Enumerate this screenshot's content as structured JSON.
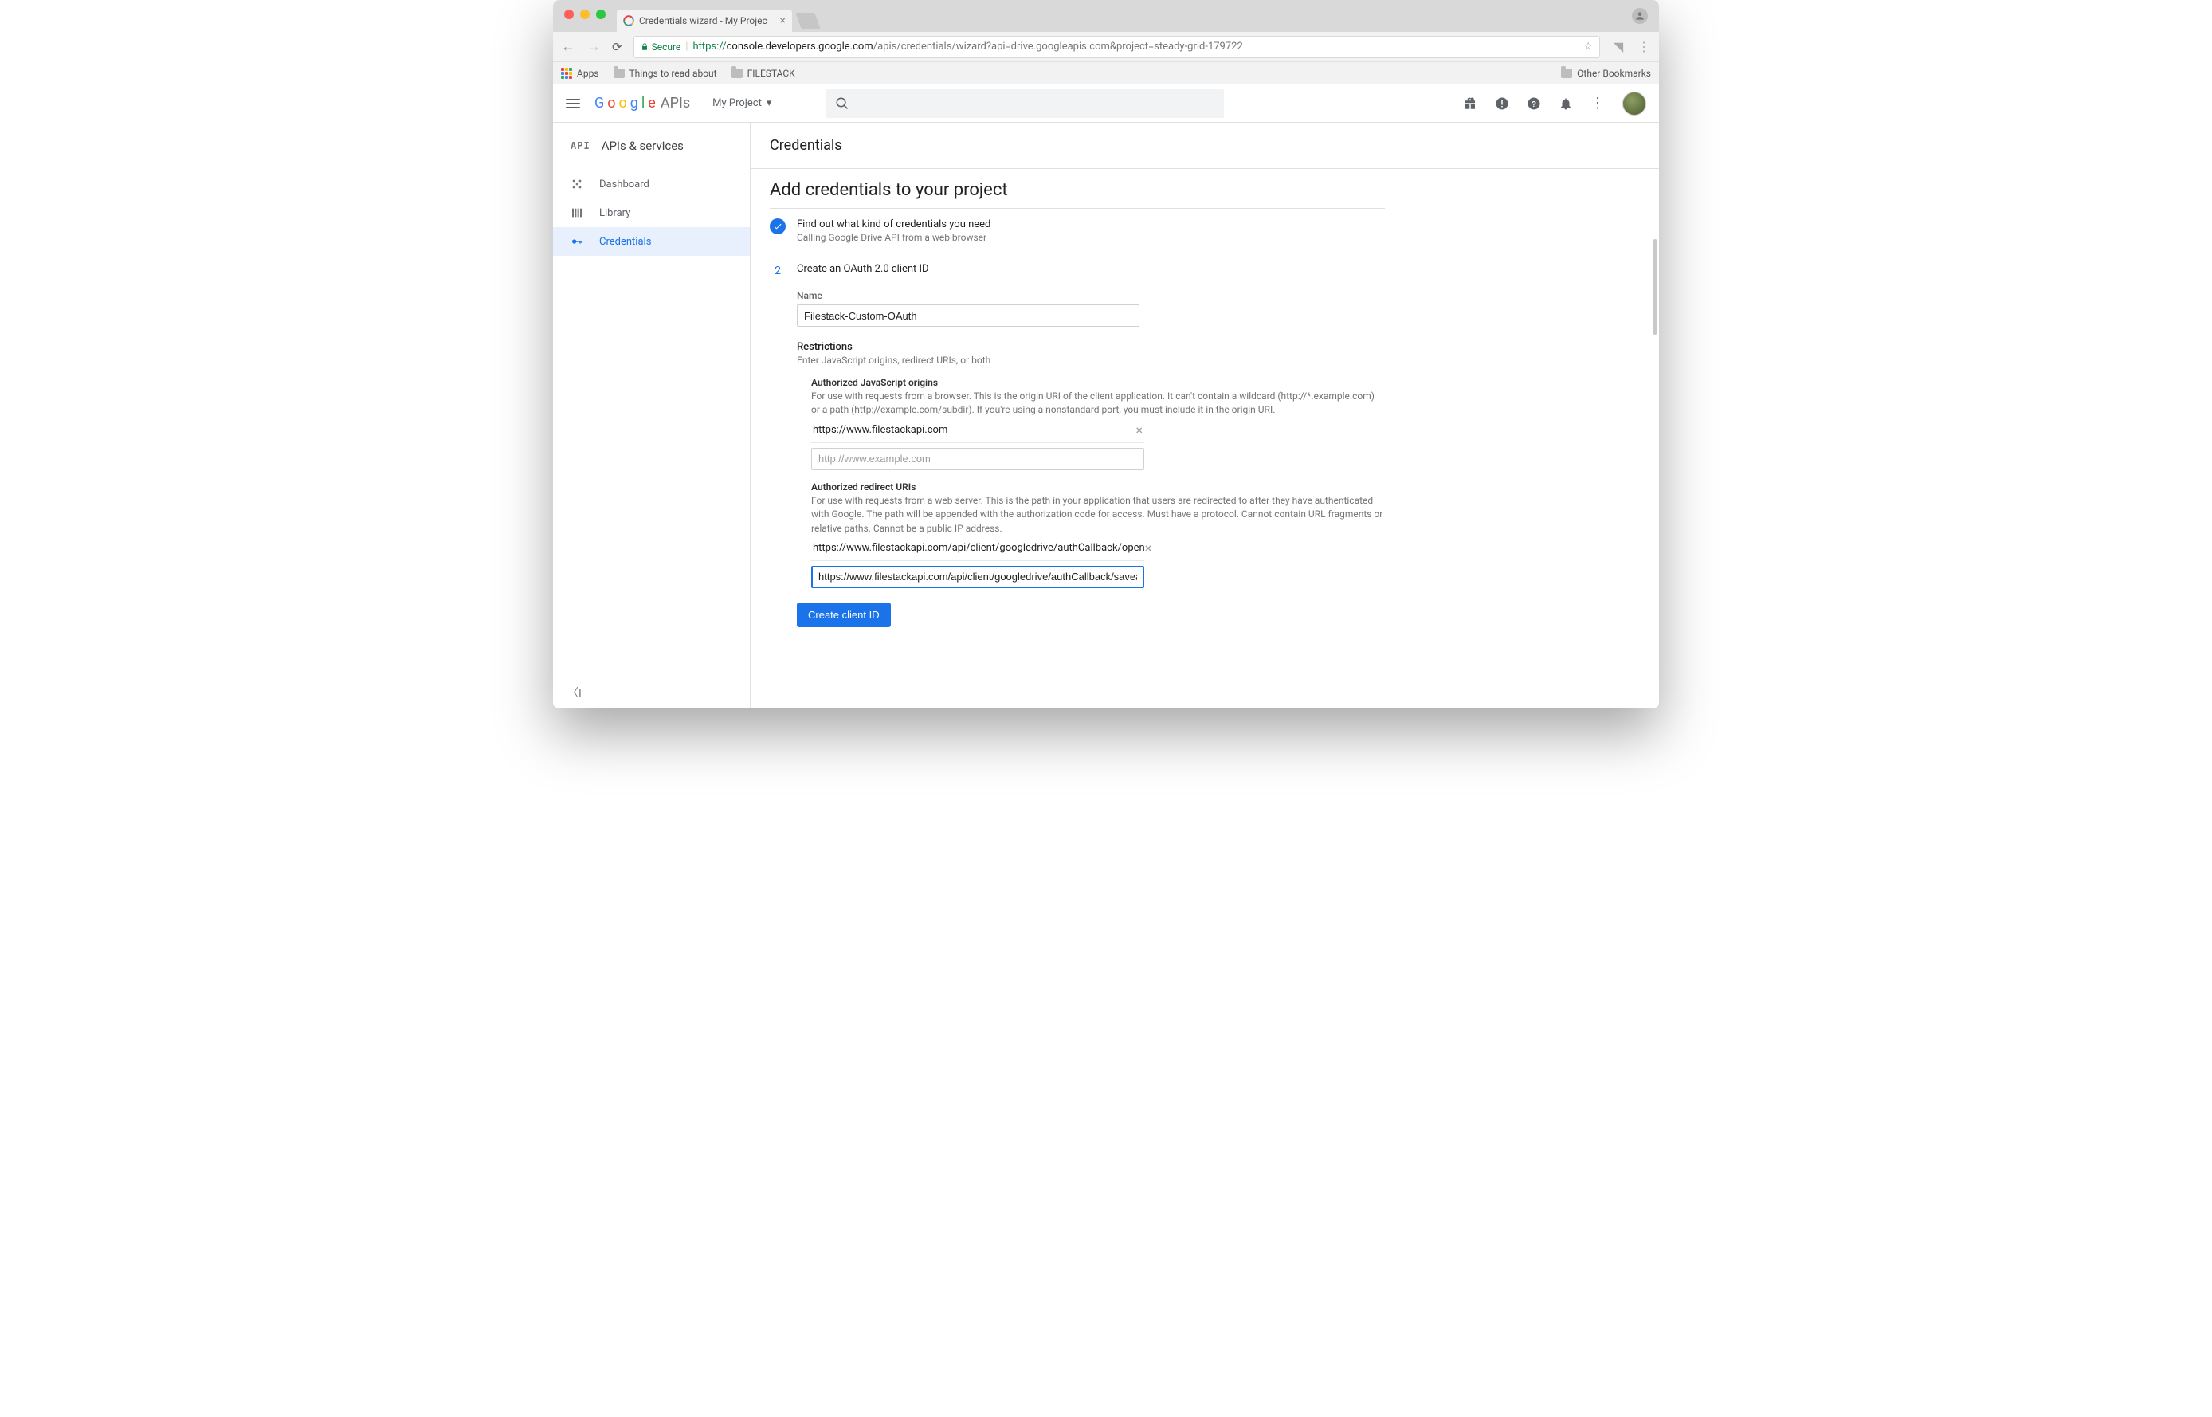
{
  "browser": {
    "tab_title": "Credentials wizard - My Projec",
    "secure_label": "Secure",
    "url_scheme": "https://",
    "url_host": "console.developers.google.com",
    "url_path": "/apis/credentials/wizard?api=drive.googleapis.com&project=steady-grid-179722",
    "bookmarks": {
      "apps": "Apps",
      "items": [
        "Things to read about",
        "FILESTACK"
      ],
      "other": "Other Bookmarks"
    }
  },
  "header": {
    "logo_suffix": "APIs",
    "project": "My Project"
  },
  "sidebar": {
    "section": "APIs & services",
    "items": [
      {
        "label": "Dashboard"
      },
      {
        "label": "Library"
      },
      {
        "label": "Credentials"
      }
    ]
  },
  "page": {
    "title": "Credentials",
    "heading": "Add credentials to your project",
    "step1": {
      "title": "Find out what kind of credentials you need",
      "sub": "Calling Google Drive API from a web browser"
    },
    "step2": {
      "num": "2",
      "title": "Create an OAuth 2.0 client ID",
      "name_label": "Name",
      "name_value": "Filestack-Custom-OAuth",
      "restrictions": "Restrictions",
      "restrictions_help": "Enter JavaScript origins, redirect URIs, or both",
      "js": {
        "title": "Authorized JavaScript origins",
        "help": "For use with requests from a browser. This is the origin URI of the client application. It can't contain a wildcard (http://*.example.com) or a path (http://example.com/subdir). If you're using a nonstandard port, you must include it in the origin URI.",
        "entries": [
          "https://www.filestackapi.com"
        ],
        "placeholder": "http://www.example.com"
      },
      "redir": {
        "title": "Authorized redirect URIs",
        "help": "For use with requests from a web server. This is the path in your application that users are redirected to after they have authenticated with Google. The path will be appended with the authorization code for access. Must have a protocol. Cannot contain URL fragments or relative paths. Cannot be a public IP address.",
        "entries": [
          "https://www.filestackapi.com/api/client/googledrive/authCallback/open"
        ],
        "input_value": "https://www.filestackapi.com/api/client/googledrive/authCallback/saveas"
      },
      "button": "Create client ID"
    }
  }
}
